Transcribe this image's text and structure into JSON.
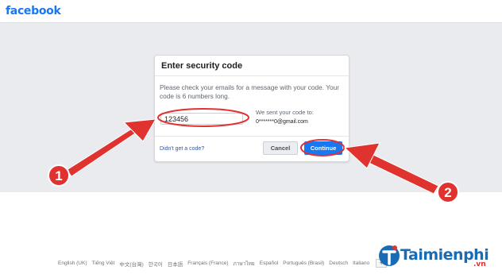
{
  "header": {
    "logo": "facebook"
  },
  "dialog": {
    "title": "Enter security code",
    "description": "Please check your emails for a message with your code. Your code is 6 numbers long.",
    "code_value": "123456",
    "sent_label": "We sent your code to:",
    "sent_email": "0*******0@gmail.com",
    "didnt_get_link": "Didn't get a code?",
    "cancel_label": "Cancel",
    "continue_label": "Continue"
  },
  "annotations": {
    "step1": "1",
    "step2": "2",
    "color": "#e0322f"
  },
  "footer": {
    "languages": [
      "English (UK)",
      "Tiếng Việt",
      "中文(台灣)",
      "한국어",
      "日本語",
      "Français (France)",
      "ภาษาไทย",
      "Español",
      "Português (Brasil)",
      "Deutsch",
      "Italiano"
    ],
    "more": "+"
  },
  "watermark": {
    "brand": "Taimienphi",
    "domain": ".vn"
  },
  "colors": {
    "facebook_blue": "#1877f2",
    "background": "#e9ebee",
    "link": "#385898"
  }
}
